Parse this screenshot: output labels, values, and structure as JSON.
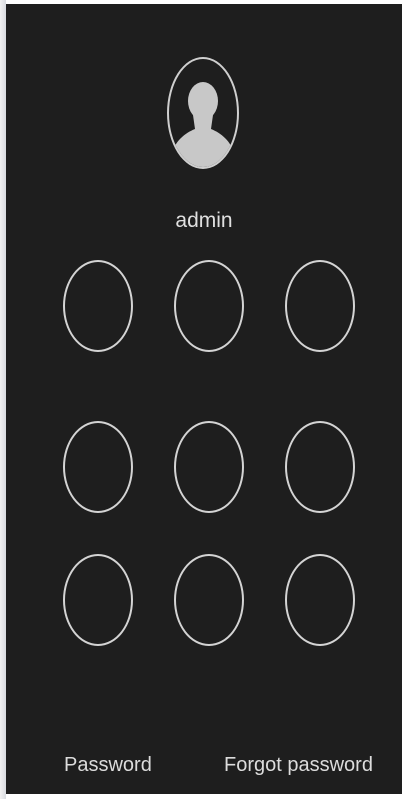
{
  "user": {
    "name": "admin",
    "avatar_icon": "user-silhouette-icon"
  },
  "pattern": {
    "rows": 3,
    "cols": 3,
    "stroke_color": "#d4d4d4"
  },
  "footer": {
    "password_label": "Password",
    "forgot_label": "Forgot password"
  },
  "colors": {
    "background": "#1e1e1e",
    "foreground": "#e0e0e0"
  }
}
